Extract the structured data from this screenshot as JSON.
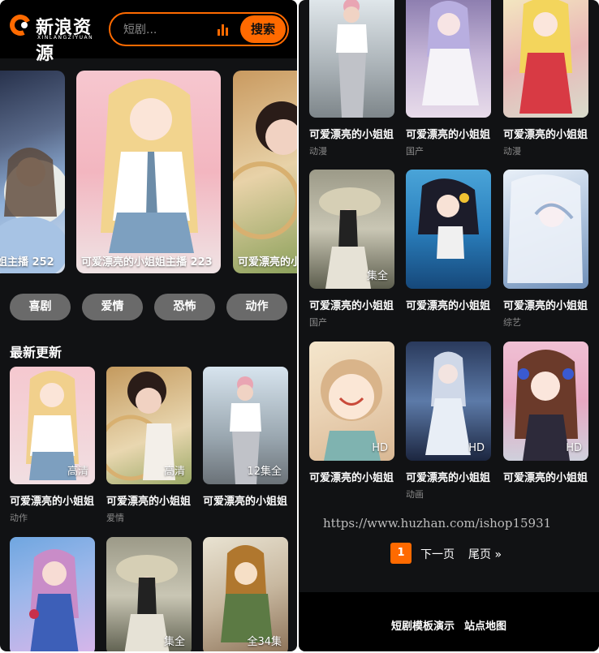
{
  "header": {
    "logo_text": "新浪资源",
    "logo_sub": "XINLANGZIYUAN",
    "search_placeholder": "短剧...",
    "search_button": "搜索"
  },
  "carousel": [
    {
      "caption": "姐主播 252"
    },
    {
      "caption": "可爱漂亮的小姐姐主播 223"
    },
    {
      "caption": "可爱漂亮的小"
    }
  ],
  "categories": [
    "喜剧",
    "爱情",
    "恐怖",
    "动作"
  ],
  "latest": {
    "title": "最新更新",
    "items": [
      {
        "title": "可爱漂亮的小姐姐",
        "tag": "动作",
        "badge": "高清"
      },
      {
        "title": "可爱漂亮的小姐姐",
        "tag": "爱情",
        "badge": "高清"
      },
      {
        "title": "可爱漂亮的小姐姐",
        "tag": "",
        "badge": "12集全"
      },
      {
        "title": "",
        "tag": "",
        "badge": ""
      },
      {
        "title": "",
        "tag": "",
        "badge": "集全"
      },
      {
        "title": "",
        "tag": "",
        "badge": "全34集"
      }
    ]
  },
  "grid": [
    {
      "title": "可爱漂亮的小姐姐",
      "tag": "动漫",
      "badge": ""
    },
    {
      "title": "可爱漂亮的小姐姐",
      "tag": "国产",
      "badge": ""
    },
    {
      "title": "可爱漂亮的小姐姐",
      "tag": "动漫",
      "badge": ""
    },
    {
      "title": "可爱漂亮的小姐姐",
      "tag": "国产",
      "badge": "集全"
    },
    {
      "title": "可爱漂亮的小姐姐",
      "tag": "",
      "badge": ""
    },
    {
      "title": "可爱漂亮的小姐姐",
      "tag": "综艺",
      "badge": ""
    },
    {
      "title": "可爱漂亮的小姐姐",
      "tag": "",
      "badge": "HD"
    },
    {
      "title": "可爱漂亮的小姐姐",
      "tag": "动画",
      "badge": "HD"
    },
    {
      "title": "可爱漂亮的小姐姐",
      "tag": "",
      "badge": "HD"
    }
  ],
  "watermark": "https://www.huzhan.com/ishop15931",
  "pagination": {
    "current": "1",
    "next": "下一页",
    "last": "尾页 »"
  },
  "footer": {
    "link1": "短剧模板演示",
    "link2": "站点地图"
  }
}
